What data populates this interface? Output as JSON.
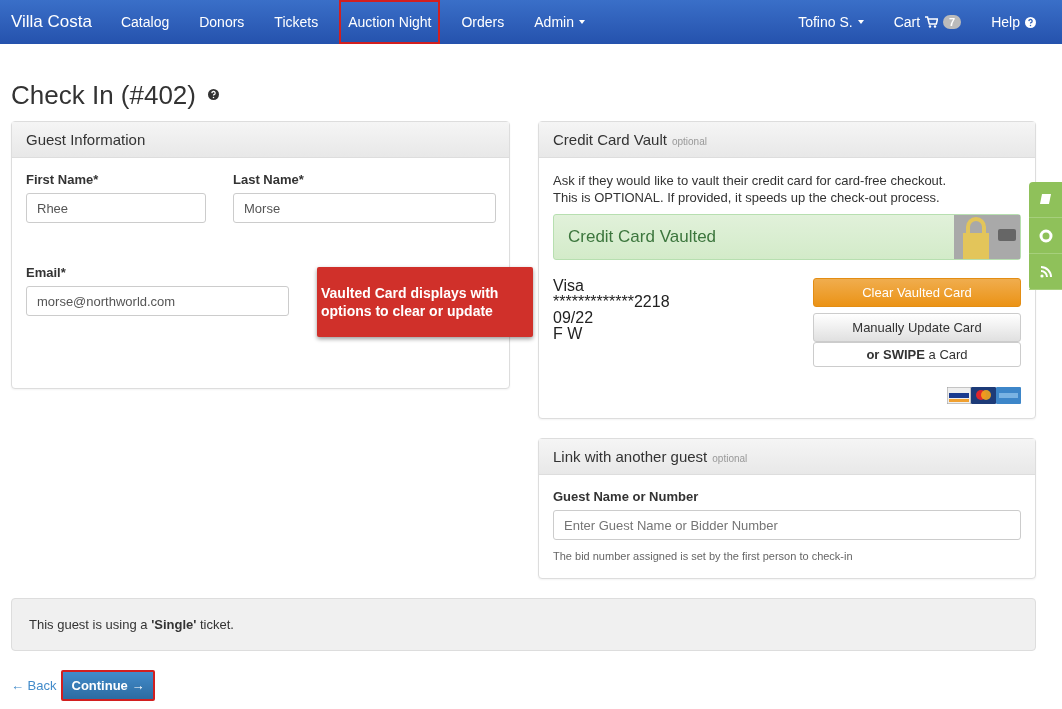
{
  "navbar": {
    "brand": "Villa Costa",
    "items": [
      {
        "label": "Catalog",
        "dropdown": false,
        "highlighted": false
      },
      {
        "label": "Donors",
        "dropdown": false,
        "highlighted": false
      },
      {
        "label": "Tickets",
        "dropdown": false,
        "highlighted": false
      },
      {
        "label": "Auction Night",
        "dropdown": false,
        "highlighted": true
      },
      {
        "label": "Orders",
        "dropdown": false,
        "highlighted": false
      },
      {
        "label": "Admin",
        "dropdown": true,
        "highlighted": false
      }
    ],
    "right_items": [
      {
        "kind": "user",
        "label": "Tofino S."
      },
      {
        "kind": "cart",
        "label": "Cart",
        "badge": "7"
      },
      {
        "kind": "help",
        "label": "Help"
      }
    ]
  },
  "page_title": "Check In (#402)",
  "guest_information": {
    "title": "Guest Information",
    "fields": [
      {
        "label": "First Name*",
        "value": "Rhee"
      },
      {
        "label": "Last Name*",
        "value": "Morse"
      },
      {
        "label": "Email*",
        "value": "morse@northworld.com"
      }
    ]
  },
  "callout": "Vaulted Card displays with options to clear or update",
  "credit_card_vault": {
    "title": "Credit Card Vault",
    "tag": "optional",
    "description": [
      "Ask if they would like to vault their credit card for card-free checkout.",
      "This is OPTIONAL. If provided, it speeds up the check-out process."
    ],
    "status": "Credit Card Vaulted",
    "card": {
      "brand": "Visa",
      "number": "*************2218",
      "expiry": "09/22",
      "holder": "F W"
    },
    "buttons": [
      {
        "kind": "warning",
        "label": "Clear Vaulted Card"
      },
      {
        "kind": "default",
        "label": "Manually Update Card"
      },
      {
        "kind": "plain",
        "label": "**or SWIPE** a Card"
      }
    ]
  },
  "link_guest": {
    "title": "Link with another guest",
    "tag": "optional",
    "field_label": "Guest Name or Number",
    "placeholder": "Enter Guest Name or Bidder Number",
    "help": "The bid number assigned is set by the first person to check-in"
  },
  "ticket_note": "This guest is using a **'Single'** ticket.",
  "footer": {
    "back": "← Back",
    "continue": "Continue →",
    "continue_highlighted": true
  }
}
